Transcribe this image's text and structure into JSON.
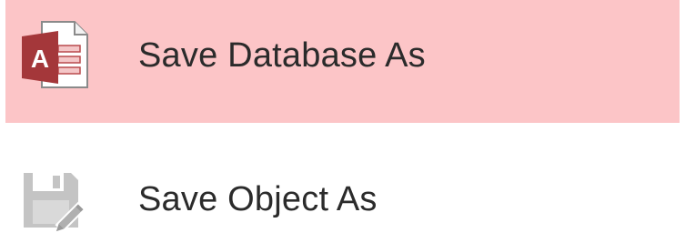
{
  "menu": {
    "items": [
      {
        "label": "Save Database As",
        "icon": "access-database-icon",
        "state": "highlighted"
      },
      {
        "label": "Save Object As",
        "icon": "save-object-icon",
        "state": "normal"
      }
    ]
  },
  "colors": {
    "highlight_background": "#fcc5c7",
    "access_red": "#a4373a",
    "text": "#2b2b2b",
    "disabled_icon_gray": "#bdbdbd"
  },
  "icons": {
    "access_glyph_letter": "A"
  }
}
